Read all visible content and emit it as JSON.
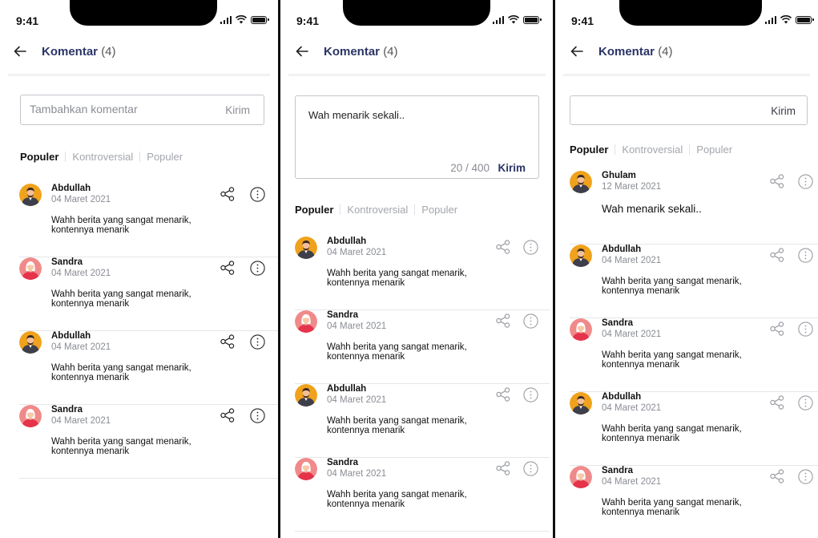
{
  "screens": [
    {
      "status": {
        "time": "9:41"
      },
      "header": {
        "title": "Komentar",
        "count": "(4)"
      },
      "input": {
        "placeholder": "Tambahkan komentar",
        "value": "",
        "send_label": "Kirim",
        "char_count": ""
      },
      "tabs": [
        "Populer",
        "Kontroversial",
        "Populer"
      ],
      "comments": [
        {
          "author": "Abdullah",
          "date": "04 Maret 2021",
          "text": "Wahh berita yang sangat menarik, kontennya menarik",
          "avatar": "abdullah"
        },
        {
          "author": "Sandra",
          "date": "04 Maret 2021",
          "text": "Wahh berita yang sangat menarik, kontennya menarik",
          "avatar": "sandra"
        },
        {
          "author": "Abdullah",
          "date": "04 Maret 2021",
          "text": "Wahh berita yang sangat menarik, kontennya menarik",
          "avatar": "abdullah"
        },
        {
          "author": "Sandra",
          "date": "04 Maret 2021",
          "text": "Wahh berita yang sangat menarik, kontennya menarik",
          "avatar": "sandra"
        }
      ]
    },
    {
      "status": {
        "time": "9:41"
      },
      "header": {
        "title": "Komentar",
        "count": "(4)"
      },
      "input": {
        "placeholder": "",
        "value": "Wah menarik sekali..",
        "send_label": "Kirim",
        "char_count": "20 / 400"
      },
      "tabs": [
        "Populer",
        "Kontroversial",
        "Populer"
      ],
      "comments": [
        {
          "author": "Abdullah",
          "date": "04 Maret 2021",
          "text": "Wahh berita yang sangat menarik, kontennya menarik",
          "avatar": "abdullah"
        },
        {
          "author": "Sandra",
          "date": "04 Maret 2021",
          "text": "Wahh berita yang sangat menarik, kontennya menarik",
          "avatar": "sandra"
        },
        {
          "author": "Abdullah",
          "date": "04 Maret 2021",
          "text": "Wahh berita yang sangat menarik, kontennya menarik",
          "avatar": "abdullah"
        },
        {
          "author": "Sandra",
          "date": "04 Maret 2021",
          "text": "Wahh berita yang sangat menarik, kontennya menarik",
          "avatar": "sandra"
        }
      ]
    },
    {
      "status": {
        "time": "9:41"
      },
      "header": {
        "title": "Komentar",
        "count": "(4)"
      },
      "input": {
        "placeholder": "",
        "value": "",
        "send_label": "Kirim",
        "char_count": ""
      },
      "tabs": [
        "Populer",
        "Kontroversial",
        "Populer"
      ],
      "comments": [
        {
          "author": "Ghulam",
          "date": "12 Maret 2021",
          "text": "Wah menarik sekali..",
          "avatar": "ghulam"
        },
        {
          "author": "Abdullah",
          "date": "04 Maret 2021",
          "text": "Wahh berita yang sangat menarik, kontennya menarik",
          "avatar": "abdullah"
        },
        {
          "author": "Sandra",
          "date": "04 Maret 2021",
          "text": "Wahh berita yang sangat menarik, kontennya menarik",
          "avatar": "sandra"
        },
        {
          "author": "Abdullah",
          "date": "04 Maret 2021",
          "text": "Wahh berita yang sangat menarik, kontennya menarik",
          "avatar": "abdullah"
        },
        {
          "author": "Sandra",
          "date": "04 Maret 2021",
          "text": "Wahh berita yang sangat menarik, kontennya menarik",
          "avatar": "sandra"
        }
      ]
    }
  ],
  "colors": {
    "accent": "#2b3466",
    "muted": "#8a8d94",
    "avatar_male_bg": "#f0a21c",
    "avatar_female_bg": "#f08a8a"
  }
}
